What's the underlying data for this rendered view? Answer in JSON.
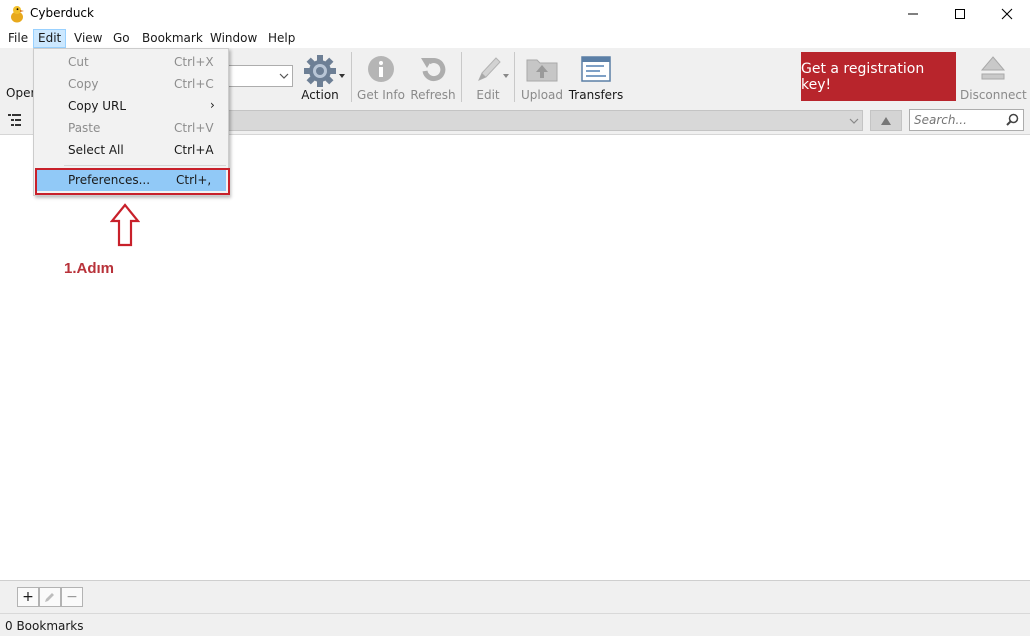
{
  "window": {
    "title": "Cyberduck",
    "min_glyph": "—",
    "max_glyph": "☐",
    "close_glyph": "✕"
  },
  "menubar": {
    "items": [
      "File",
      "Edit",
      "View",
      "Go",
      "Bookmark",
      "Window",
      "Help"
    ],
    "active": "Edit"
  },
  "toolbar": {
    "open_label": "Oper",
    "action_label": "Action",
    "get_info_label": "Get Info",
    "refresh_label": "Refresh",
    "edit_label": "Edit",
    "upload_label": "Upload",
    "transfers_label": "Transfers",
    "registration_label": "Get a registration key!",
    "disconnect_label": "Disconnect"
  },
  "pathbar": {
    "search_placeholder": "Search..."
  },
  "edit_menu": {
    "cut": {
      "label": "Cut",
      "shortcut": "Ctrl+X",
      "enabled": false
    },
    "copy": {
      "label": "Copy",
      "shortcut": "Ctrl+C",
      "enabled": false
    },
    "copy_url": {
      "label": "Copy URL",
      "submenu_glyph": "›",
      "enabled": true
    },
    "paste": {
      "label": "Paste",
      "shortcut": "Ctrl+V",
      "enabled": false
    },
    "select_all": {
      "label": "Select All",
      "shortcut": "Ctrl+A",
      "enabled": true
    },
    "preferences": {
      "label": "Preferences...",
      "shortcut": "Ctrl+,",
      "enabled": true
    }
  },
  "annotation": {
    "step_text": "1.Adım",
    "color": "#c8202a"
  },
  "bookmarks": {
    "add_glyph": "+",
    "remove_glyph": "−"
  },
  "status": {
    "text": "0 Bookmarks"
  },
  "colors": {
    "accent_red": "#b8252c",
    "menu_highlight": "#91c9f7",
    "menu_active": "#cce8ff"
  }
}
